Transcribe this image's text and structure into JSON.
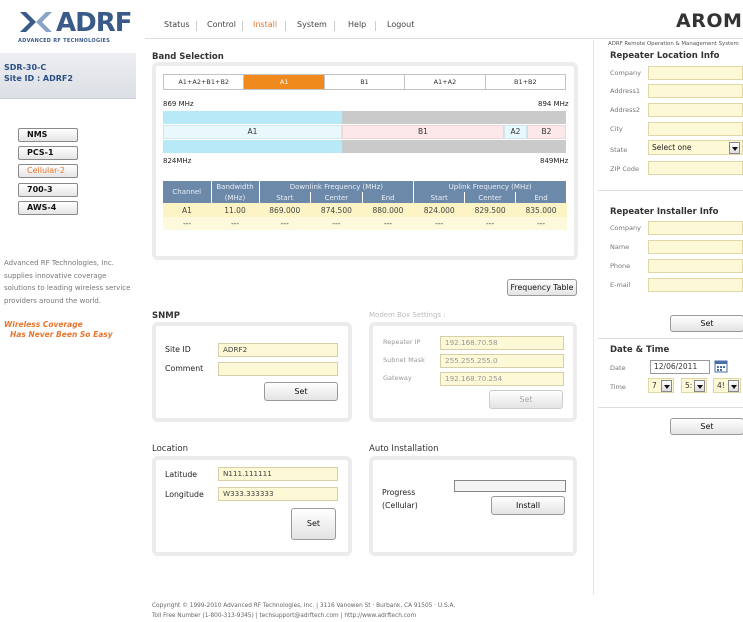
{
  "brand": {
    "logo_text": "ADRF",
    "logo_sub": "ADVANCED RF TECHNOLOGIES",
    "product": "AROMS",
    "product_sub": "ADRF Remote Operation & Management System"
  },
  "device": {
    "model": "SDR-30-C",
    "site_id": "Site ID : ADRF2"
  },
  "nav": [
    "Status",
    "Control",
    "Install",
    "System",
    "Help",
    "Logout"
  ],
  "nav_active": "Install",
  "side_buttons": [
    "NMS",
    "PCS-1",
    "Cellular-2",
    "700-3",
    "AWS-4"
  ],
  "side_selected": "Cellular-2",
  "description": [
    "Advanced RF Technologies, Inc.",
    "supplies innovative coverage",
    "solutions to leading wireless service",
    "providers around the world."
  ],
  "slogan": [
    "Wireless Coverage",
    "Has Never Been So Easy"
  ],
  "band_selection": {
    "title": "Band Selection",
    "options": [
      "A1+A2+B1+B2",
      "A1",
      "B1",
      "A1+A2",
      "B1+B2"
    ],
    "selected": "A1",
    "freq_top_left": "869 MHz",
    "freq_top_right": "894 MHz",
    "freq_bottom_left": "824MHz",
    "freq_bottom_right": "849MHz",
    "segments": [
      "A1",
      "B1",
      "A2",
      "B2"
    ],
    "table": {
      "headers": {
        "channel": "Channel",
        "bandwidth": "Bandwidth",
        "bandwidth_unit": "(MHz)",
        "downlink": "Downlink Frequency (MHz)",
        "uplink": "Uplink Frequency (MHz)",
        "start": "Start",
        "center": "Center",
        "end": "End"
      },
      "rows": [
        [
          "A1",
          "11.00",
          "869.000",
          "874.500",
          "880.000",
          "824.000",
          "829.500",
          "835.000"
        ],
        [
          "---",
          "---",
          "---",
          "---",
          "---",
          "---",
          "---",
          "---"
        ]
      ]
    },
    "freq_table_button": "Frequency Table"
  },
  "snmp": {
    "title": "SNMP",
    "site_id_label": "Site ID",
    "site_id": "ADRF2",
    "comment_label": "Comment",
    "comment": "",
    "set": "Set"
  },
  "modem": {
    "title": "Modem Box Settings :",
    "ip_label": "Repeater IP",
    "ip": "192.168.70.58",
    "mask_label": "Subnet Mask",
    "mask": "255.255.255.0",
    "gw_label": "Gateway",
    "gw": "192.168.70.254",
    "set": "Set"
  },
  "location": {
    "title": "Location",
    "lat_label": "Latitude",
    "lat": "N111.111111",
    "lon_label": "Longitude",
    "lon": "W333.333333",
    "set": "Set"
  },
  "auto_install": {
    "title": "Auto Installation",
    "progress_label": "Progress",
    "band_label": "(Cellular)",
    "progress": 0,
    "install": "Install"
  },
  "repeater_location": {
    "title": "Repeater Location Info",
    "fields": [
      "Company",
      "Address1",
      "Address2",
      "City",
      "State",
      "ZIP Code"
    ],
    "state_value": "Select one"
  },
  "installer": {
    "title": "Repeater Installer Info",
    "fields": [
      "Company",
      "Name",
      "Phone",
      "E-mail"
    ],
    "set": "Set"
  },
  "datetime": {
    "title": "Date & Time",
    "date_label": "Date",
    "date": "12/06/2011",
    "time_label": "Time",
    "hour": "7",
    "minute": "5:",
    "second": "4!",
    "set": "Set"
  },
  "footer": {
    "line1": "Copyright © 1999-2010 Advanced RF Technologies, Inc. | 3116 Vanowen St · Burbank, CA 91505 · U.S.A.",
    "line2": "Toll Free Number (1-800-313-9345) | techsupport@adrftech.com | http://www.adrftech.com"
  }
}
